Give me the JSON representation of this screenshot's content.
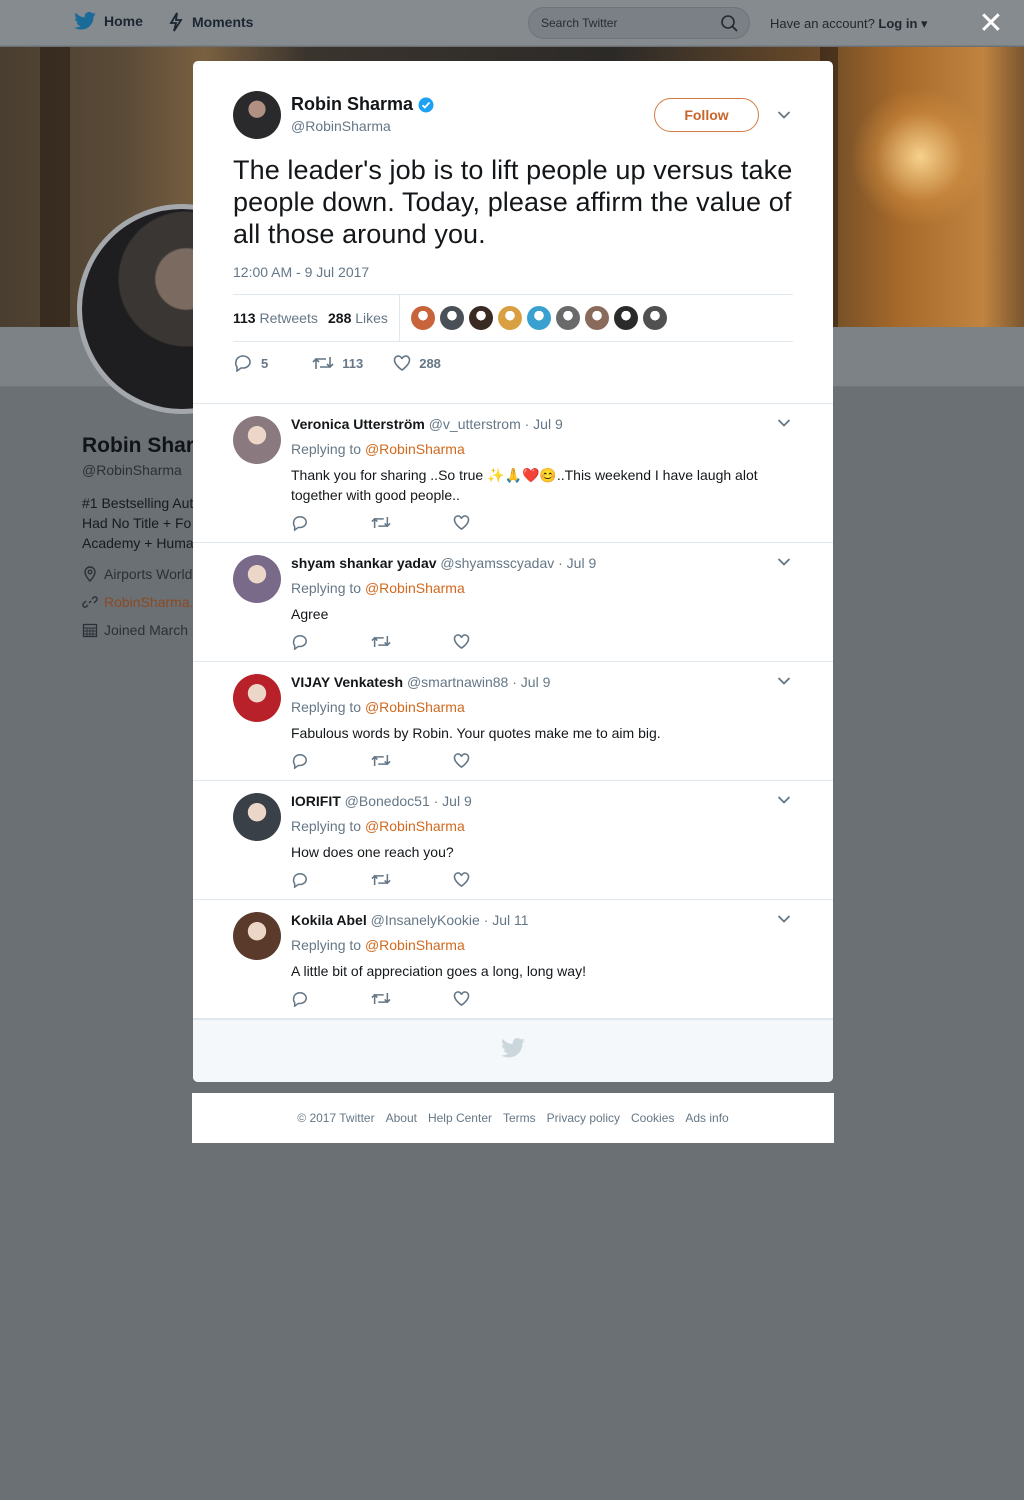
{
  "topbar": {
    "home_label": "Home",
    "moments_label": "Moments",
    "search_placeholder": "Search Twitter",
    "have_account": "Have an account?",
    "login_label": "Log in",
    "close_glyph": "✕"
  },
  "profile_bg": {
    "name": "Robin Shar",
    "handle": "@RobinSharma",
    "bio_lines": [
      "#1 Bestselling Aut",
      "Had No Title + Fo",
      "Academy + Huma"
    ],
    "location": "Airports World",
    "website": "RobinSharma.",
    "joined": "Joined March"
  },
  "tweet": {
    "author_name": "Robin Sharma",
    "author_handle": "@RobinSharma",
    "verified": true,
    "follow_label": "Follow",
    "text": "The leader's job is to lift people up versus take people down. Today, please affirm the value of all those around you.",
    "timestamp": "12:00 AM - 9 Jul 2017",
    "retweets_count": "113",
    "retweets_label": "Retweets",
    "likes_count": "288",
    "likes_label": "Likes",
    "likers_colors": [
      "#c8643c",
      "#4a5058",
      "#3a2a24",
      "#d8a040",
      "#3aa0d0",
      "#6a6a6a",
      "#8a6a5a",
      "#2a2a2a",
      "#505050"
    ],
    "reply_count": "5",
    "retweet_count": "113",
    "like_count": "288"
  },
  "replies": [
    {
      "name": "Veronica Utterström",
      "handle": "@v_utterstrom",
      "date": "· Jul 9",
      "replying_prefix": "Replying to",
      "replying_to": "@RobinSharma",
      "text": "Thank you for sharing ..So true ✨🙏❤️😊..This weekend I have laugh alot together with good people..",
      "avatar_color": "#8a7a80"
    },
    {
      "name": "shyam shankar yadav",
      "handle": "@shyamsscyadav",
      "date": "· Jul 9",
      "replying_prefix": "Replying to",
      "replying_to": "@RobinSharma",
      "text": "Agree",
      "avatar_color": "#7a6a8a"
    },
    {
      "name": "VIJAY Venkatesh",
      "handle": "@smartnawin88",
      "date": "· Jul 9",
      "replying_prefix": "Replying to",
      "replying_to": "@RobinSharma",
      "text": "Fabulous words by Robin. Your quotes make me to aim big.",
      "avatar_color": "#b8202a"
    },
    {
      "name": "IORIFIT",
      "handle": "@Bonedoc51",
      "date": "· Jul 9",
      "replying_prefix": "Replying to",
      "replying_to": "@RobinSharma",
      "text": "How does one reach you?",
      "avatar_color": "#3a4048"
    },
    {
      "name": "Kokila Abel",
      "handle": "@InsanelyKookie",
      "date": "· Jul 11",
      "replying_prefix": "Replying to",
      "replying_to": "@RobinSharma",
      "text": "A little bit of appreciation goes a long, long way!",
      "avatar_color": "#5a3a2a"
    }
  ],
  "footer": {
    "copyright": "© 2017 Twitter",
    "links": [
      "About",
      "Help Center",
      "Terms",
      "Privacy policy",
      "Cookies",
      "Ads info"
    ]
  },
  "colors": {
    "accent": "#c8652a",
    "twitter_blue": "#1da1f2",
    "overlay": "#6b7075"
  }
}
